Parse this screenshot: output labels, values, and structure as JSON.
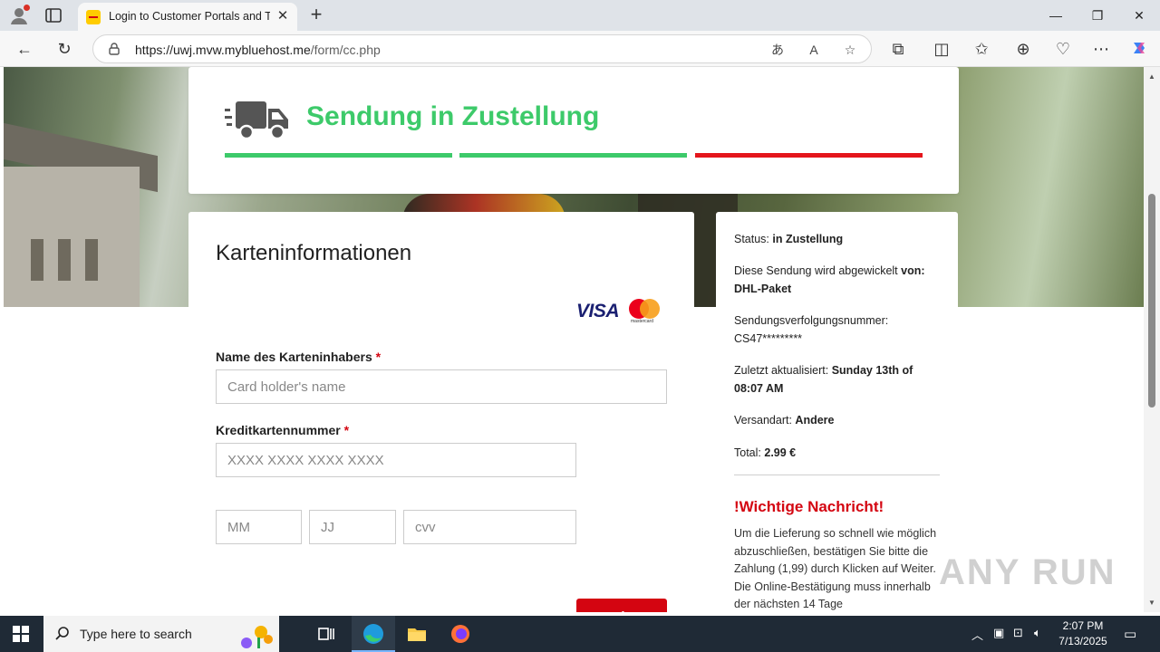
{
  "browser": {
    "tab_title": "Login to Customer Portals and To",
    "url_host": "https://uwj.mvw.mybluehost.me",
    "url_path": "/form/cc.php"
  },
  "status_card": {
    "title": "Sendung in Zustellung",
    "progress_segments": [
      {
        "color": "#3dca6a"
      },
      {
        "color": "#3dca6a"
      },
      {
        "color": "#e4161c"
      }
    ]
  },
  "form": {
    "title": "Karteninformationen",
    "card_brands": [
      "VISA",
      "mastercard"
    ],
    "name_label": "Name des Karteninhabers",
    "name_placeholder": "Card holder's name",
    "number_label": "Kreditkartennummer",
    "number_placeholder": "XXXX XXXX XXXX XXXX",
    "required_mark": "*",
    "mm_placeholder": "MM",
    "jj_placeholder": "JJ",
    "cvv_placeholder": "cvv",
    "submit_label": "Weiter"
  },
  "info": {
    "status_label": "Status:",
    "status_value": "in Zustellung",
    "handled_text": "Diese Sendung wird abgewickelt",
    "handled_von": "von:",
    "handled_value": "DHL-Paket",
    "tracking_label": "Sendungsverfolgungsnummer:",
    "tracking_value": "CS47*********",
    "updated_label": "Zuletzt aktualisiert:",
    "updated_value": "Sunday 13th of 08:07 AM",
    "shipping_label": "Versandart:",
    "shipping_value": "Andere",
    "total_label": "Total:",
    "total_value": "2.99 €",
    "warning_title": "!Wichtige Nachricht!",
    "warning_text": "Um die Lieferung so schnell wie möglich abzuschließen, bestätigen Sie bitte die Zahlung (1,99) durch Klicken auf Weiter. Die Online-Bestätigung muss innerhalb der nächsten 14 Tage"
  },
  "watermark": "ANY RUN",
  "taskbar": {
    "search_placeholder": "Type here to search",
    "time": "2:07 PM",
    "date": "7/13/2025"
  },
  "colors": {
    "accent_green": "#3dca6a",
    "accent_red": "#d40511"
  }
}
